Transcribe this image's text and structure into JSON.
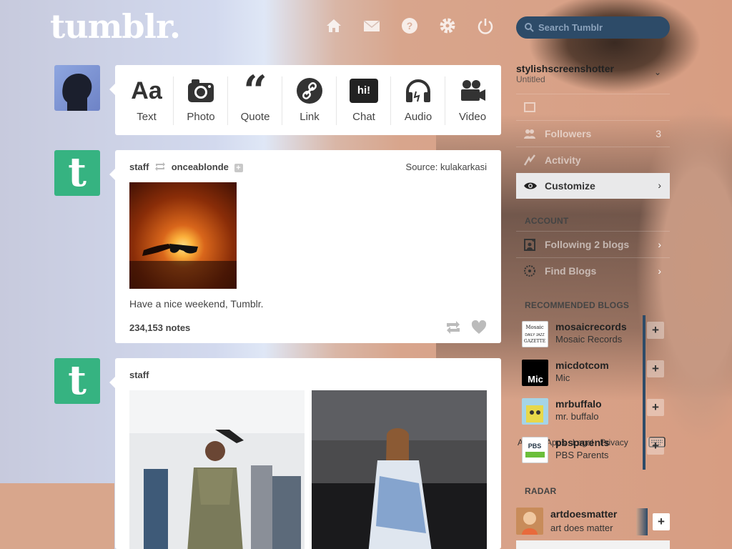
{
  "header": {
    "logo": "tumblr.",
    "nav": [
      "home-icon",
      "mail-icon",
      "help-icon",
      "gear-icon",
      "power-icon"
    ],
    "search_placeholder": "Search Tumblr"
  },
  "composer": {
    "types": [
      {
        "label": "Text",
        "icon": "text-icon"
      },
      {
        "label": "Photo",
        "icon": "camera-icon"
      },
      {
        "label": "Quote",
        "icon": "quote-icon"
      },
      {
        "label": "Link",
        "icon": "link-icon"
      },
      {
        "label": "Chat",
        "icon": "chat-icon"
      },
      {
        "label": "Audio",
        "icon": "headphones-icon"
      },
      {
        "label": "Video",
        "icon": "video-camera-icon"
      }
    ],
    "text_glyph": "Aa",
    "chat_glyph": "hi!"
  },
  "post1": {
    "author": "staff",
    "reblogged_from": "onceablonde",
    "source_label": "Source:",
    "source": "kulakarkasi",
    "body": "Have a nice weekend, Tumblr.",
    "notes": "234,153 notes"
  },
  "post2": {
    "author": "staff"
  },
  "sidebar": {
    "blog_name": "stylishscreenshotter",
    "blog_title": "Untitled",
    "menu": [
      {
        "label": "Followers",
        "count": "3",
        "icon": "people-icon"
      },
      {
        "label": "Activity",
        "icon": "activity-icon"
      }
    ],
    "customize": "Customize",
    "account_heading": "ACCOUNT",
    "account_items": [
      {
        "label": "Following 2 blogs",
        "icon": "add-person-icon"
      },
      {
        "label": "Find Blogs",
        "icon": "compass-icon"
      }
    ],
    "recommended_heading": "RECOMMENDED BLOGS",
    "recommended": [
      {
        "name": "mosaicrecords",
        "title": "Mosaic Records",
        "thumb_text": "Mosaic\nDAILY JAZZ\nGAZETTE"
      },
      {
        "name": "micdotcom",
        "title": "Mic",
        "thumb_text": "Mic"
      },
      {
        "name": "mrbuffalo",
        "title": "mr. buffalo",
        "thumb_text": ""
      },
      {
        "name": "pbsparents",
        "title": "PBS Parents",
        "thumb_text": "PBS"
      }
    ],
    "footer_links": [
      "About",
      "Apps",
      "Legal",
      "Privacy"
    ],
    "radar_heading": "RADAR",
    "radar": {
      "name": "artdoesmatter",
      "title": "art does matter"
    }
  }
}
